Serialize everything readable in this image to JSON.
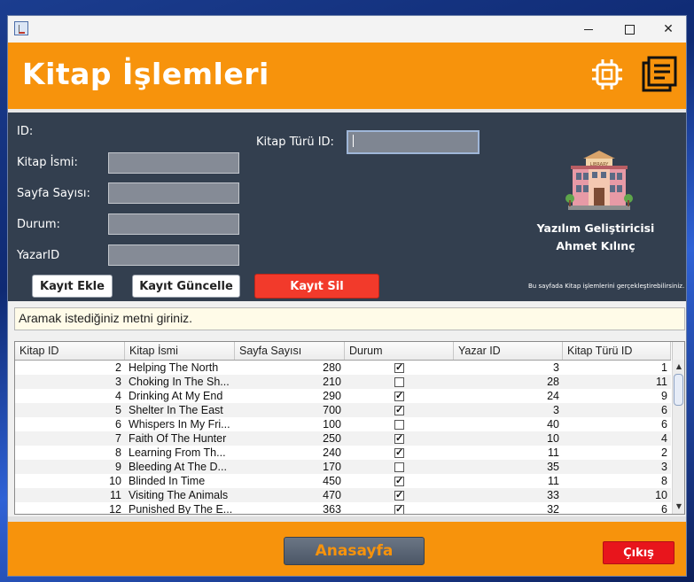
{
  "window": {
    "close_glyph": "✕"
  },
  "header": {
    "title": "Kitap İşlemleri",
    "icons": [
      "cpu-icon",
      "notes-icon"
    ]
  },
  "form": {
    "id_label": "ID:",
    "name_label": "Kitap İsmi:",
    "pages_label": "Sayfa Sayısı:",
    "status_label": "Durum:",
    "author_label": "YazarID",
    "type_label": "Kitap Türü ID:",
    "name_value": "",
    "pages_value": "",
    "status_value": "",
    "author_value": "",
    "type_value": "",
    "add_button": "Kayıt Ekle",
    "update_button": "Kayıt Güncelle",
    "delete_button": "Kayıt Sil"
  },
  "developer": {
    "line1": "Yazılım Geliştiricisi",
    "line2": "Ahmet Kılınç",
    "note": "Bu sayfada Kitap işlemlerini gerçekleştirebilirsiniz."
  },
  "search": {
    "value": "Aramak istediğiniz metni giriniz."
  },
  "table": {
    "columns": [
      "Kitap ID",
      "Kitap İsmi",
      "Sayfa Sayısı",
      "Durum",
      "Yazar ID",
      "Kitap Türü ID"
    ],
    "rows": [
      {
        "id": "2",
        "name": "Helping The North",
        "pages": "280",
        "status": true,
        "author": "3",
        "type": "1"
      },
      {
        "id": "3",
        "name": "Choking In The Sh...",
        "pages": "210",
        "status": false,
        "author": "28",
        "type": "11"
      },
      {
        "id": "4",
        "name": "Drinking At My End",
        "pages": "290",
        "status": true,
        "author": "24",
        "type": "9"
      },
      {
        "id": "5",
        "name": "Shelter In The East",
        "pages": "700",
        "status": true,
        "author": "3",
        "type": "6"
      },
      {
        "id": "6",
        "name": "Whispers In My Fri...",
        "pages": "100",
        "status": false,
        "author": "40",
        "type": "6"
      },
      {
        "id": "7",
        "name": "Faith Of The Hunter",
        "pages": "250",
        "status": true,
        "author": "10",
        "type": "4"
      },
      {
        "id": "8",
        "name": "Learning From Th...",
        "pages": "240",
        "status": true,
        "author": "11",
        "type": "2"
      },
      {
        "id": "9",
        "name": "Bleeding At The D...",
        "pages": "170",
        "status": false,
        "author": "35",
        "type": "3"
      },
      {
        "id": "10",
        "name": "Blinded In Time",
        "pages": "450",
        "status": true,
        "author": "11",
        "type": "8"
      },
      {
        "id": "11",
        "name": "Visiting The Animals",
        "pages": "470",
        "status": true,
        "author": "33",
        "type": "10"
      },
      {
        "id": "12",
        "name": "Punished By The E...",
        "pages": "363",
        "status": true,
        "author": "32",
        "type": "6"
      }
    ]
  },
  "footer": {
    "home_button": "Anasayfa",
    "exit_button": "Çıkış"
  },
  "colors": {
    "accent": "#f7930c",
    "panel": "#333f4f",
    "danger": "#f23a2b"
  }
}
